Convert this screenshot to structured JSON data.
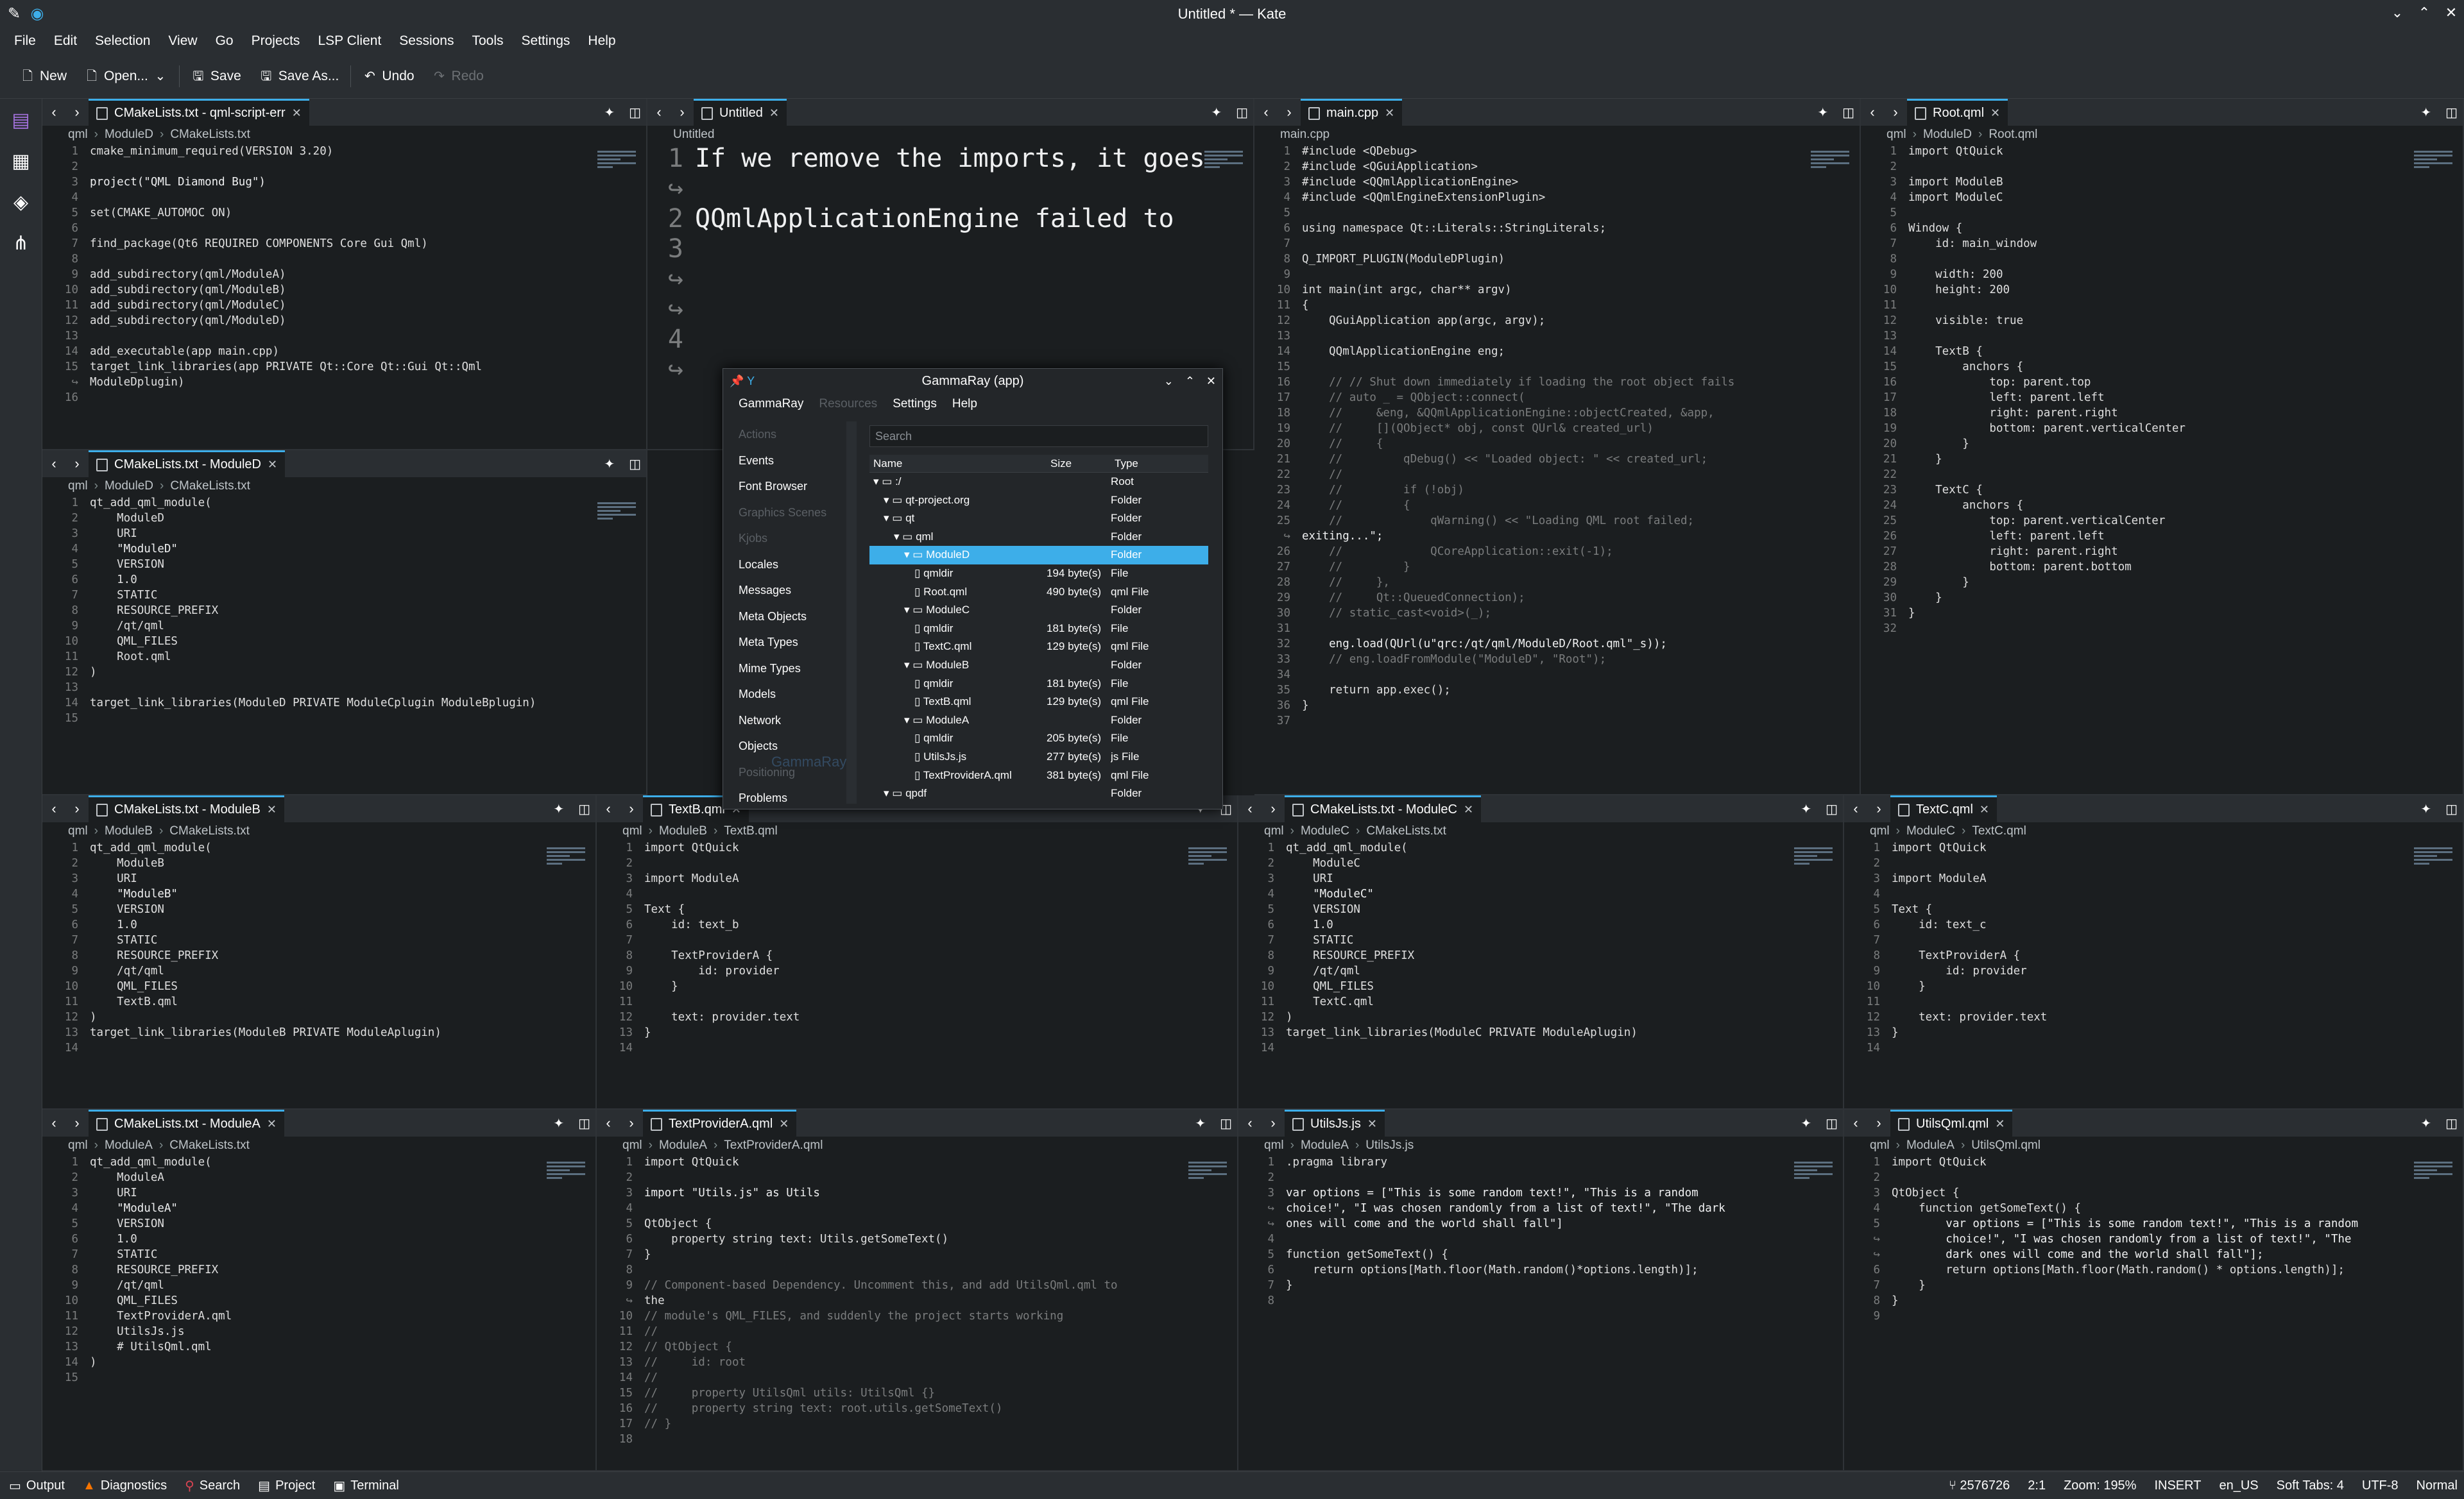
{
  "window": {
    "title": "Untitled * — Kate"
  },
  "menu": [
    "File",
    "Edit",
    "Selection",
    "View",
    "Go",
    "Projects",
    "LSP Client",
    "Sessions",
    "Tools",
    "Settings",
    "Help"
  ],
  "toolbar": {
    "new": "New",
    "open": "Open...",
    "save": "Save",
    "save_as": "Save As...",
    "undo": "Undo",
    "redo": "Redo"
  },
  "colors": {
    "accent": "#3daee9",
    "keyword": "#fdbc4b",
    "string": "#f44f4f",
    "func": "#8e44ad",
    "number": "#f67400",
    "comment": "#7a7c7d"
  },
  "panes": [
    {
      "tab": "CMakeLists.txt - qml-script-err",
      "crumb": [
        "qml",
        "ModuleD",
        "CMakeLists.txt"
      ],
      "lines": [
        "cmake_minimum_required(VERSION 3.20)",
        "",
        "project(\"QML Diamond Bug\")",
        "",
        "set(CMAKE_AUTOMOC ON)",
        "",
        "find_package(Qt6 REQUIRED COMPONENTS Core Gui Qml)",
        "",
        "add_subdirectory(qml/ModuleA)",
        "add_subdirectory(qml/ModuleB)",
        "add_subdirectory(qml/ModuleC)",
        "add_subdirectory(qml/ModuleD)",
        "",
        "add_executable(app main.cpp)",
        "target_link_libraries(app PRIVATE Qt::Core Qt::Gui Qt::Qml",
        "ModuleDplugin)",
        ""
      ],
      "nums": [
        "1",
        "2",
        "3",
        "4",
        "5",
        "6",
        "7",
        "8",
        "9",
        "10",
        "11",
        "12",
        "13",
        "14",
        "15",
        "↪",
        "16"
      ]
    },
    {
      "tab": "Untitled",
      "crumb": [
        "Untitled"
      ],
      "lines": [
        "If we remove the imports, it goes back to failing with:",
        "",
        "QQmlApplicationEngine failed to load component <Unknown File>: No module named \"ModuleD\" found"
      ],
      "nums": [
        "1",
        "↪",
        "2",
        "3",
        "↪",
        "↪",
        "4",
        "↪"
      ]
    },
    {
      "tab": "main.cpp",
      "crumb": [
        "main.cpp"
      ],
      "lines": [
        "#include <QDebug>",
        "#include <QGuiApplication>",
        "#include <QQmlApplicationEngine>",
        "#include <QQmlEngineExtensionPlugin>",
        "",
        "using namespace Qt::Literals::StringLiterals;",
        "",
        "Q_IMPORT_PLUGIN(ModuleDPlugin)",
        "",
        "int main(int argc, char** argv)",
        "{",
        "    QGuiApplication app(argc, argv);",
        "",
        "    QQmlApplicationEngine eng;",
        "",
        "    // // Shut down immediately if loading the root object fails",
        "    // auto _ = QObject::connect(",
        "    //     &eng, &QQmlApplicationEngine::objectCreated, &app,",
        "    //     [](QObject* obj, const QUrl& created_url)",
        "    //     {",
        "    //         qDebug() << \"Loaded object: \" << created_url;",
        "    //",
        "    //         if (!obj)",
        "    //         {",
        "    //             qWarning() << \"Loading QML root failed;",
        "exiting...\";",
        "    //             QCoreApplication::exit(-1);",
        "    //         }",
        "    //     },",
        "    //     Qt::QueuedConnection);",
        "    // static_cast<void>(_);",
        "",
        "    eng.load(QUrl(u\"qrc:/qt/qml/ModuleD/Root.qml\"_s));",
        "    // eng.loadFromModule(\"ModuleD\", \"Root\");",
        "",
        "    return app.exec();",
        "}",
        ""
      ],
      "nums": [
        "1",
        "2",
        "3",
        "4",
        "5",
        "6",
        "7",
        "8",
        "9",
        "10",
        "11",
        "12",
        "13",
        "14",
        "15",
        "16",
        "17",
        "18",
        "19",
        "20",
        "21",
        "22",
        "23",
        "24",
        "25",
        "↪",
        "26",
        "27",
        "28",
        "29",
        "30",
        "31",
        "32",
        "33",
        "34",
        "35",
        "36",
        "37"
      ]
    },
    {
      "tab": "Root.qml",
      "crumb": [
        "qml",
        "ModuleD",
        "Root.qml"
      ],
      "lines": [
        "import QtQuick",
        "",
        "import ModuleB",
        "import ModuleC",
        "",
        "Window {",
        "    id: main_window",
        "",
        "    width: 200",
        "    height: 200",
        "",
        "    visible: true",
        "",
        "    TextB {",
        "        anchors {",
        "            top: parent.top",
        "            left: parent.left",
        "            right: parent.right",
        "            bottom: parent.verticalCenter",
        "        }",
        "    }",
        "",
        "    TextC {",
        "        anchors {",
        "            top: parent.verticalCenter",
        "            left: parent.left",
        "            right: parent.right",
        "            bottom: parent.bottom",
        "        }",
        "    }",
        "}",
        ""
      ],
      "nums": [
        "1",
        "2",
        "3",
        "4",
        "5",
        "6",
        "7",
        "8",
        "9",
        "10",
        "11",
        "12",
        "13",
        "14",
        "15",
        "16",
        "17",
        "18",
        "19",
        "20",
        "21",
        "22",
        "23",
        "24",
        "25",
        "26",
        "27",
        "28",
        "29",
        "30",
        "31",
        "32"
      ]
    },
    {
      "tab": "CMakeLists.txt - ModuleD",
      "crumb": [
        "qml",
        "ModuleD",
        "CMakeLists.txt"
      ],
      "lines": [
        "qt_add_qml_module(",
        "    ModuleD",
        "    URI",
        "    \"ModuleD\"",
        "    VERSION",
        "    1.0",
        "    STATIC",
        "    RESOURCE_PREFIX",
        "    /qt/qml",
        "    QML_FILES",
        "    Root.qml",
        ")",
        "",
        "target_link_libraries(ModuleD PRIVATE ModuleCplugin ModuleBplugin)",
        ""
      ],
      "nums": [
        "1",
        "2",
        "3",
        "4",
        "5",
        "6",
        "7",
        "8",
        "9",
        "10",
        "11",
        "12",
        "13",
        "14",
        "15"
      ]
    },
    {
      "tab": "CMakeLists.txt - ModuleB",
      "crumb": [
        "qml",
        "ModuleB",
        "CMakeLists.txt"
      ],
      "lines": [
        "qt_add_qml_module(",
        "    ModuleB",
        "    URI",
        "    \"ModuleB\"",
        "    VERSION",
        "    1.0",
        "    STATIC",
        "    RESOURCE_PREFIX",
        "    /qt/qml",
        "    QML_FILES",
        "    TextB.qml",
        ")",
        "target_link_libraries(ModuleB PRIVATE ModuleAplugin)",
        ""
      ],
      "nums": [
        "1",
        "2",
        "3",
        "4",
        "5",
        "6",
        "7",
        "8",
        "9",
        "10",
        "11",
        "12",
        "13",
        "14"
      ]
    },
    {
      "tab": "TextB.qml",
      "crumb": [
        "qml",
        "ModuleB",
        "TextB.qml"
      ],
      "lines": [
        "import QtQuick",
        "",
        "import ModuleA",
        "",
        "Text {",
        "    id: text_b",
        "",
        "    TextProviderA {",
        "        id: provider",
        "    }",
        "",
        "    text: provider.text",
        "}",
        ""
      ],
      "nums": [
        "1",
        "2",
        "3",
        "4",
        "5",
        "6",
        "7",
        "8",
        "9",
        "10",
        "11",
        "12",
        "13",
        "14"
      ]
    },
    {
      "tab": "CMakeLists.txt - ModuleC",
      "crumb": [
        "qml",
        "ModuleC",
        "CMakeLists.txt"
      ],
      "lines": [
        "qt_add_qml_module(",
        "    ModuleC",
        "    URI",
        "    \"ModuleC\"",
        "    VERSION",
        "    1.0",
        "    STATIC",
        "    RESOURCE_PREFIX",
        "    /qt/qml",
        "    QML_FILES",
        "    TextC.qml",
        ")",
        "target_link_libraries(ModuleC PRIVATE ModuleAplugin)",
        ""
      ],
      "nums": [
        "1",
        "2",
        "3",
        "4",
        "5",
        "6",
        "7",
        "8",
        "9",
        "10",
        "11",
        "12",
        "13",
        "14"
      ]
    },
    {
      "tab": "TextC.qml",
      "crumb": [
        "qml",
        "ModuleC",
        "TextC.qml"
      ],
      "lines": [
        "import QtQuick",
        "",
        "import ModuleA",
        "",
        "Text {",
        "    id: text_c",
        "",
        "    TextProviderA {",
        "        id: provider",
        "    }",
        "",
        "    text: provider.text",
        "}",
        ""
      ],
      "nums": [
        "1",
        "2",
        "3",
        "4",
        "5",
        "6",
        "7",
        "8",
        "9",
        "10",
        "11",
        "12",
        "13",
        "14"
      ]
    },
    {
      "tab": "CMakeLists.txt - ModuleA",
      "crumb": [
        "qml",
        "ModuleA",
        "CMakeLists.txt"
      ],
      "lines": [
        "qt_add_qml_module(",
        "    ModuleA",
        "    URI",
        "    \"ModuleA\"",
        "    VERSION",
        "    1.0",
        "    STATIC",
        "    RESOURCE_PREFIX",
        "    /qt/qml",
        "    QML_FILES",
        "    TextProviderA.qml",
        "    UtilsJs.js",
        "    # UtilsQml.qml",
        ")",
        ""
      ],
      "nums": [
        "1",
        "2",
        "3",
        "4",
        "5",
        "6",
        "7",
        "8",
        "9",
        "10",
        "11",
        "12",
        "13",
        "14",
        "15"
      ]
    },
    {
      "tab": "TextProviderA.qml",
      "crumb": [
        "qml",
        "ModuleA",
        "TextProviderA.qml"
      ],
      "lines": [
        "import QtQuick",
        "",
        "import \"Utils.js\" as Utils",
        "",
        "QtObject {",
        "    property string text: Utils.getSomeText()",
        "}",
        "",
        "// Component-based Dependency. Uncomment this, and add UtilsQml.qml to",
        "the",
        "// module's QML_FILES, and suddenly the project starts working",
        "//",
        "// QtObject {",
        "//     id: root",
        "//",
        "//     property UtilsQml utils: UtilsQml {}",
        "//     property string text: root.utils.getSomeText()",
        "// }",
        ""
      ],
      "nums": [
        "1",
        "2",
        "3",
        "4",
        "5",
        "6",
        "7",
        "8",
        "9",
        "↪",
        "10",
        "11",
        "12",
        "13",
        "14",
        "15",
        "16",
        "17",
        "18"
      ]
    },
    {
      "tab": "UtilsJs.js",
      "crumb": [
        "qml",
        "ModuleA",
        "UtilsJs.js"
      ],
      "lines": [
        ".pragma library",
        "",
        "var options = [\"This is some random text!\", \"This is a random",
        "choice!\", \"I was chosen randomly from a list of text!\", \"The dark",
        "ones will come and the world shall fall\"]",
        "",
        "function getSomeText() {",
        "    return options[Math.floor(Math.random()*options.length)];",
        "}",
        ""
      ],
      "nums": [
        "1",
        "2",
        "3",
        "↪",
        "↪",
        "4",
        "5",
        "6",
        "7",
        "8"
      ]
    },
    {
      "tab": "UtilsQml.qml",
      "crumb": [
        "qml",
        "ModuleA",
        "UtilsQml.qml"
      ],
      "lines": [
        "import QtQuick",
        "",
        "QtObject {",
        "    function getSomeText() {",
        "        var options = [\"This is some random text!\", \"This is a random",
        "        choice!\", \"I was chosen randomly from a list of text!\", \"The",
        "        dark ones will come and the world shall fall\"];",
        "        return options[Math.floor(Math.random() * options.length)];",
        "    }",
        "}",
        ""
      ],
      "nums": [
        "1",
        "2",
        "3",
        "4",
        "5",
        "↪",
        "↪",
        "6",
        "7",
        "8",
        "9"
      ]
    }
  ],
  "gammaray": {
    "title": "GammaRay (app)",
    "menu": [
      "GammaRay",
      "Resources",
      "Settings",
      "Help"
    ],
    "tools": [
      "Actions",
      "Events",
      "Font Browser",
      "Graphics Scenes",
      "Kjobs",
      "Locales",
      "Messages",
      "Meta Objects",
      "Meta Types",
      "Mime Types",
      "Models",
      "Network",
      "Objects",
      "Positioning",
      "Problems"
    ],
    "disabled_tools": [
      "Actions",
      "Graphics Scenes",
      "Kjobs",
      "Positioning"
    ],
    "search_placeholder": "Search",
    "watermark": "GammaRay",
    "columns": [
      "Name",
      "Size",
      "Type"
    ],
    "rows": [
      {
        "name": ":/",
        "size": "",
        "type": "Root",
        "indent": 0
      },
      {
        "name": "qt-project.org",
        "size": "",
        "type": "Folder",
        "indent": 1
      },
      {
        "name": "qt",
        "size": "",
        "type": "Folder",
        "indent": 1
      },
      {
        "name": "qml",
        "size": "",
        "type": "Folder",
        "indent": 2
      },
      {
        "name": "ModuleD",
        "size": "",
        "type": "Folder",
        "indent": 3,
        "selected": true
      },
      {
        "name": "qmldir",
        "size": "194 byte(s)",
        "type": "File",
        "indent": 4
      },
      {
        "name": "Root.qml",
        "size": "490 byte(s)",
        "type": "qml File",
        "indent": 4
      },
      {
        "name": "ModuleC",
        "size": "",
        "type": "Folder",
        "indent": 3
      },
      {
        "name": "qmldir",
        "size": "181 byte(s)",
        "type": "File",
        "indent": 4
      },
      {
        "name": "TextC.qml",
        "size": "129 byte(s)",
        "type": "qml File",
        "indent": 4
      },
      {
        "name": "ModuleB",
        "size": "",
        "type": "Folder",
        "indent": 3
      },
      {
        "name": "qmldir",
        "size": "181 byte(s)",
        "type": "File",
        "indent": 4
      },
      {
        "name": "TextB.qml",
        "size": "129 byte(s)",
        "type": "qml File",
        "indent": 4
      },
      {
        "name": "ModuleA",
        "size": "",
        "type": "Folder",
        "indent": 3
      },
      {
        "name": "qmldir",
        "size": "205 byte(s)",
        "type": "File",
        "indent": 4
      },
      {
        "name": "UtilsJs.js",
        "size": "277 byte(s)",
        "type": "js File",
        "indent": 4
      },
      {
        "name": "TextProviderA.qml",
        "size": "381 byte(s)",
        "type": "qml File",
        "indent": 4
      },
      {
        "name": "qpdf",
        "size": "",
        "type": "Folder",
        "indent": 1
      }
    ]
  },
  "statusbar": {
    "left": [
      "Output",
      "Diagnostics",
      "Search",
      "Project",
      "Terminal"
    ],
    "branch": "2576726",
    "position": "2:1",
    "zoom": "Zoom: 195%",
    "mode": "INSERT",
    "lang": "en_US",
    "tabs": "Soft Tabs: 4",
    "encoding": "UTF-8",
    "input": "Normal"
  }
}
